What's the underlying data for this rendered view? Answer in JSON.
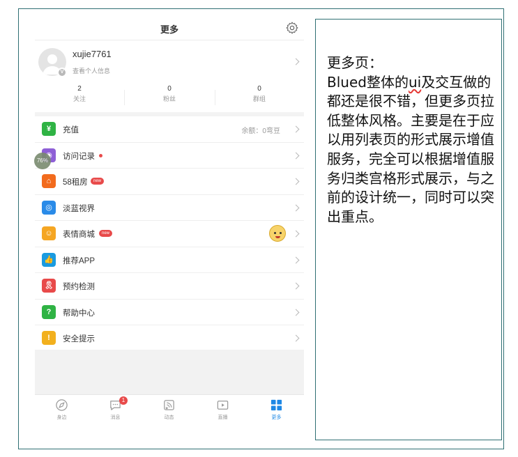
{
  "header": {
    "title": "更多"
  },
  "profile": {
    "username": "xujie7761",
    "subtitle": "查看个人信息",
    "avatar_badge": "V"
  },
  "stats": [
    {
      "value": "2",
      "label": "关注"
    },
    {
      "value": "0",
      "label": "粉丝"
    },
    {
      "value": "0",
      "label": "群组"
    }
  ],
  "menu": [
    {
      "label": "充值",
      "icon": "yen-icon",
      "icon_glyph": "¥",
      "color": "#2fb344",
      "extra": "余额：0弯豆"
    },
    {
      "label": "访问记录",
      "icon": "eye-icon",
      "icon_glyph": "◉",
      "color": "#8e5fd6",
      "dot": true
    },
    {
      "label": "58租房",
      "icon": "house-icon",
      "icon_glyph": "⌂",
      "color": "#f26b1d",
      "badge": "new"
    },
    {
      "label": "淡蓝视界",
      "icon": "globe-icon",
      "icon_glyph": "◎",
      "color": "#2a8be8"
    },
    {
      "label": "表情商城",
      "icon": "smiley-icon",
      "icon_glyph": "☺",
      "color": "#f5a623",
      "badge": "new"
    },
    {
      "label": "推荐APP",
      "icon": "thumbs-up-icon",
      "icon_glyph": "👍",
      "color": "#1a9be0"
    },
    {
      "label": "预约检测",
      "icon": "ribbon-icon",
      "icon_glyph": "🎗",
      "color": "#e84a4a"
    },
    {
      "label": "帮助中心",
      "icon": "question-icon",
      "icon_glyph": "?",
      "color": "#2fb344"
    },
    {
      "label": "安全提示",
      "icon": "shield-alert-icon",
      "icon_glyph": "!",
      "color": "#f2b01e"
    }
  ],
  "float_badge": "76%",
  "tabbar": {
    "tabs": [
      {
        "label": "身边",
        "icon": "compass-icon"
      },
      {
        "label": "消息",
        "icon": "chat-icon",
        "badge": "1"
      },
      {
        "label": "动态",
        "icon": "feed-icon"
      },
      {
        "label": "直播",
        "icon": "live-video-icon"
      },
      {
        "label": "更多",
        "icon": "grid-icon",
        "active": true
      }
    ]
  },
  "note": {
    "line1": "更多页：",
    "line2a": "Blued整体的",
    "line2b": "ui",
    "line2c": "及交互",
    "rest": "做的都还是很不错，但更多页拉低整体风格。主要是在于应以用列表页的形式展示增值服务，完全可以根据增值服务归类宫格形式展示，与之前的设计统一，同时可以突出重点。"
  },
  "colors": {
    "accent": "#1e88e5",
    "badge_red": "#e84a4a",
    "frame": "#2f6f73"
  }
}
